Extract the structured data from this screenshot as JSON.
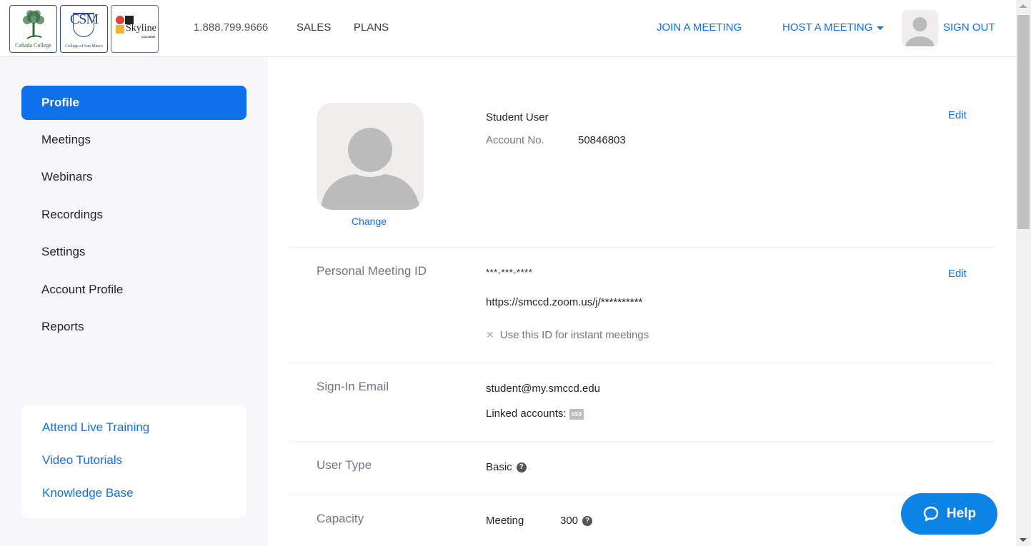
{
  "header": {
    "logos": [
      {
        "name": "Cañada College",
        "color": "#2d6b3a"
      },
      {
        "name": "College of San Mateo",
        "mark": "CSM",
        "color": "#2b4a8c"
      },
      {
        "name": "Skyline",
        "sub": "COLLEGE",
        "color": "#e0413a"
      }
    ],
    "phone": "1.888.799.9666",
    "sales": "SALES",
    "plans": "PLANS",
    "join_meeting": "JOIN A MEETING",
    "host_meeting": "HOST A MEETING",
    "sign_out": "SIGN OUT",
    "accent": "#0e71eb"
  },
  "sidebar": {
    "items": [
      {
        "label": "Profile",
        "active": true
      },
      {
        "label": "Meetings"
      },
      {
        "label": "Webinars"
      },
      {
        "label": "Recordings"
      },
      {
        "label": "Settings"
      },
      {
        "label": "Account Profile"
      },
      {
        "label": "Reports"
      }
    ],
    "resources": [
      {
        "label": "Attend Live Training"
      },
      {
        "label": "Video Tutorials"
      },
      {
        "label": "Knowledge Base"
      }
    ]
  },
  "profile": {
    "change": "Change",
    "name": "Student User",
    "account_label": "Account No.",
    "account_value": "50846803",
    "edit": "Edit",
    "pmi": {
      "label": "Personal Meeting ID",
      "value": "***-***-****",
      "url": "https://smccd.zoom.us/j/**********",
      "instant": "Use this ID for instant meetings",
      "edit": "Edit"
    },
    "email": {
      "label": "Sign-In Email",
      "value": "student@my.smccd.edu",
      "linked_label": "Linked accounts:",
      "linked_badge": "SSO"
    },
    "user_type": {
      "label": "User Type",
      "value": "Basic"
    },
    "capacity": {
      "label": "Capacity",
      "meeting_label": "Meeting",
      "meeting_value": "300"
    }
  },
  "help": {
    "label": "Help"
  }
}
